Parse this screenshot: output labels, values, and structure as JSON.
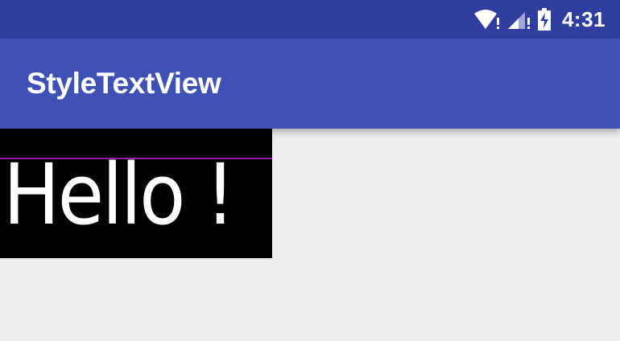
{
  "status_bar": {
    "time": "4:31",
    "icons": [
      "wifi-alert-icon",
      "cell-signal-alert-icon",
      "battery-charging-icon"
    ],
    "background": "#303f9f"
  },
  "app_bar": {
    "title": "StyleTextView",
    "background": "#3f51b5"
  },
  "content": {
    "text": "Hello !",
    "text_color": "#ffffff",
    "text_background": "#000000",
    "guide_line_color": "#8e1ea0",
    "page_background": "#eeeeee"
  }
}
